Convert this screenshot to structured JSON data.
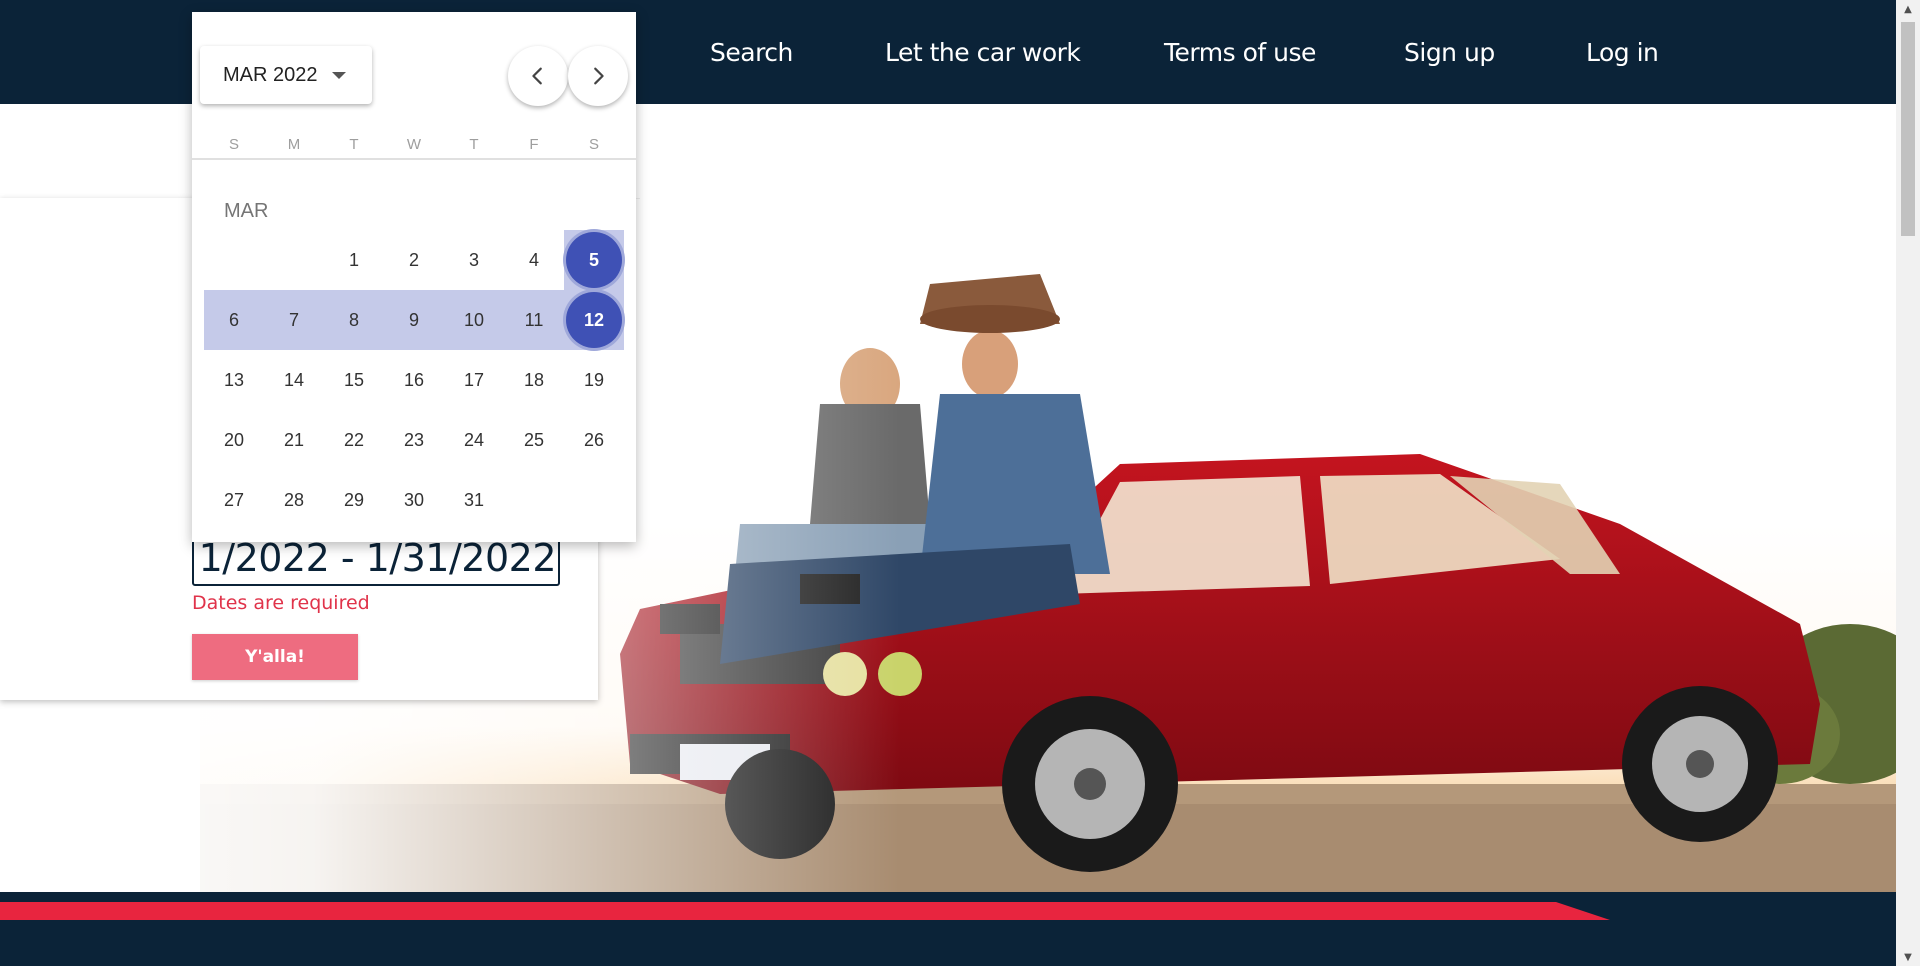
{
  "nav": {
    "items": [
      "Search",
      "Let the car work",
      "Terms of use",
      "Sign up",
      "Log in"
    ]
  },
  "search": {
    "date_value": "1/2022 - 1/31/2022",
    "error": "Dates are required",
    "submit_label": "Y'alla!"
  },
  "calendar": {
    "selected_month": "MAR 2022",
    "weekdays": [
      "S",
      "M",
      "T",
      "W",
      "T",
      "F",
      "S"
    ],
    "month_label": "MAR",
    "days": [
      "1",
      "2",
      "3",
      "4",
      "5",
      "6",
      "7",
      "8",
      "9",
      "10",
      "11",
      "12",
      "13",
      "14",
      "15",
      "16",
      "17",
      "18",
      "19",
      "20",
      "21",
      "22",
      "23",
      "24",
      "25",
      "26",
      "27",
      "28",
      "29",
      "30",
      "31"
    ],
    "range_start": "5",
    "range_end": "12"
  },
  "colors": {
    "header": "#0b2338",
    "accent_red": "#e8253f",
    "button": "#ee6c80",
    "selection": "#3f51b5",
    "range": "#c5cae9"
  },
  "icons": {
    "prev": "chevron-left-icon",
    "next": "chevron-right-icon",
    "dropdown": "caret-down-icon"
  }
}
